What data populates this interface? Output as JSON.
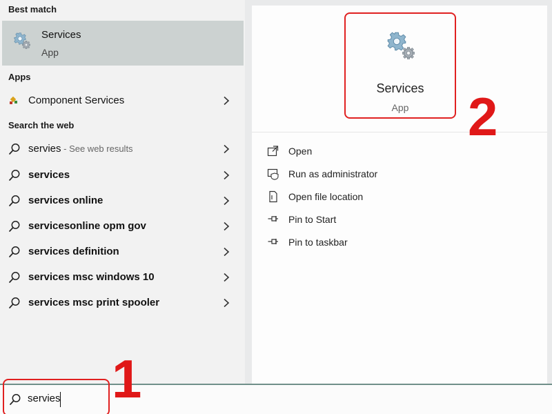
{
  "left": {
    "best_match": {
      "header": "Best match",
      "name": "Services",
      "type": "App",
      "icon": "gears-icon"
    },
    "apps": {
      "header": "Apps",
      "items": [
        {
          "label": "Component Services",
          "icon": "component-services-icon"
        }
      ]
    },
    "web": {
      "header": "Search the web",
      "items": [
        {
          "label": "servies",
          "hint": " - See web results",
          "bold": false
        },
        {
          "label": "services",
          "bold": true
        },
        {
          "label": "services online",
          "bold": true
        },
        {
          "label": "servicesonline opm gov",
          "bold": true
        },
        {
          "label": "services definition",
          "bold": true
        },
        {
          "label": "services msc windows 10",
          "bold": true
        },
        {
          "label": "services msc print spooler",
          "bold": true
        }
      ]
    }
  },
  "preview": {
    "name": "Services",
    "type": "App",
    "icon": "gears-icon",
    "actions": [
      {
        "label": "Open",
        "icon": "open-icon"
      },
      {
        "label": "Run as administrator",
        "icon": "run-as-admin-icon"
      },
      {
        "label": "Open file location",
        "icon": "file-location-icon"
      },
      {
        "label": "Pin to Start",
        "icon": "pin-icon"
      },
      {
        "label": "Pin to taskbar",
        "icon": "pin-icon"
      }
    ]
  },
  "search": {
    "value": "servies",
    "icon": "search-icon"
  },
  "annotations": {
    "step1": "1",
    "step2": "2",
    "color": "#e01818"
  }
}
